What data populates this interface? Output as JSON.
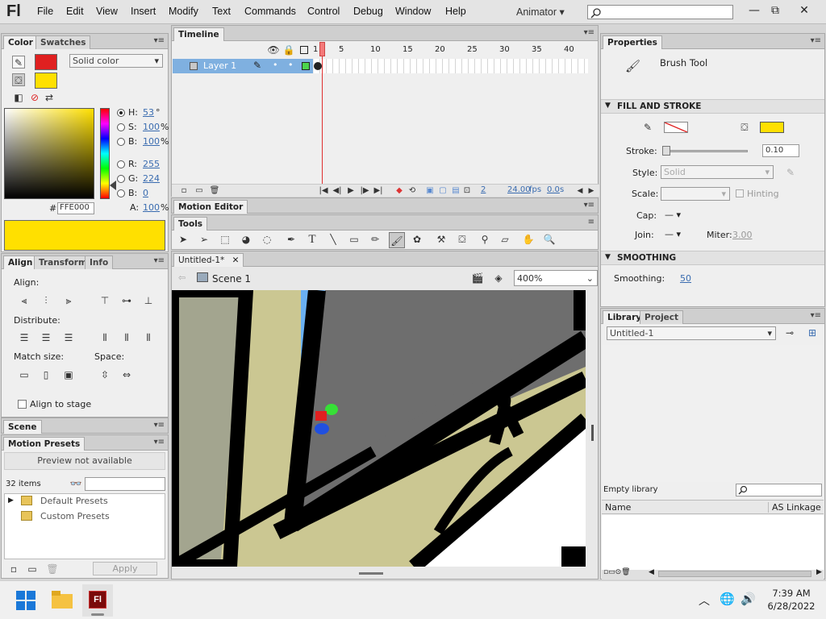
{
  "app": {
    "logo": "Fl",
    "workspace": "Animator ▾"
  },
  "menu": [
    "File",
    "Edit",
    "View",
    "Insert",
    "Modify",
    "Text",
    "Commands",
    "Control",
    "Debug",
    "Window",
    "Help"
  ],
  "color_panel": {
    "tabs": [
      "Color",
      "Swatches"
    ],
    "type": "Solid color",
    "h": "53",
    "s": "100",
    "b": "100",
    "r": "255",
    "g": "224",
    "bl": "0",
    "alpha": "100",
    "hex": "FFE000",
    "deg": "°",
    "pct": "%",
    "labels": {
      "h": "H:",
      "s": "S:",
      "b": "B:",
      "r": "R:",
      "g": "G:",
      "bl": "B:",
      "a": "A:",
      "hash": "#"
    },
    "stroke_color": "#e02020",
    "fill_color": "#ffe000"
  },
  "align_panel": {
    "tabs": [
      "Align",
      "Transform",
      "Info"
    ],
    "align": "Align:",
    "distribute": "Distribute:",
    "match": "Match size:",
    "space": "Space:",
    "stage": "Align to stage"
  },
  "scene_panel": {
    "tab": "Scene"
  },
  "presets": {
    "tab": "Motion Presets",
    "preview": "Preview not available",
    "count": "32 items",
    "items": [
      "Default Presets",
      "Custom Presets"
    ],
    "apply": "Apply"
  },
  "timeline": {
    "tab": "Timeline",
    "layer": "Layer 1",
    "frames": [
      "1",
      "5",
      "10",
      "15",
      "20",
      "25",
      "30",
      "35",
      "40"
    ],
    "current": "2",
    "fps": "24.00",
    "fps_unit": "fps",
    "time": "0.0",
    "time_unit": "s"
  },
  "motion_editor": {
    "tab": "Motion Editor"
  },
  "tools": {
    "tab": "Tools"
  },
  "document": {
    "tab": "Untitled-1*",
    "scene": "Scene 1",
    "zoom": "400%"
  },
  "properties": {
    "tab": "Properties",
    "tool": "Brush Tool",
    "fill_stroke": "FILL AND STROKE",
    "stroke_label": "Stroke:",
    "stroke_val": "0.10",
    "style_label": "Style:",
    "style_val": "Solid",
    "scale_label": "Scale:",
    "hinting": "Hinting",
    "cap": "Cap:",
    "join": "Join:",
    "miter_label": "Miter:",
    "miter_val": "3.00",
    "smoothing_hdr": "SMOOTHING",
    "smoothing_label": "Smoothing:",
    "smoothing_val": "50"
  },
  "library": {
    "tabs": [
      "Library",
      "Project"
    ],
    "doc": "Untitled-1",
    "empty": "Empty library",
    "cols": [
      "Name",
      "AS Linkage"
    ]
  },
  "taskbar": {
    "time": "7:39 AM",
    "date": "6/28/2022"
  }
}
